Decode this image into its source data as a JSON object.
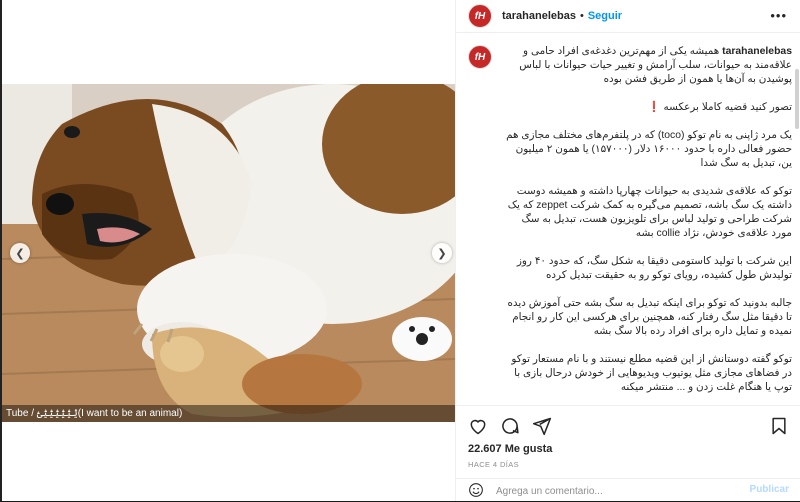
{
  "header": {
    "username": "tarahanelebas",
    "avatar_text": "fH",
    "separator": "•",
    "follow_label": "Seguir",
    "more_icon": "more-horizontal-icon"
  },
  "media": {
    "overlay_caption": "Tube / ؿؿؿؿؿؿؿ(I want to be an animal)",
    "prev_icon": "chevron-left-icon",
    "next_icon": "chevron-right-icon"
  },
  "caption": {
    "username": "tarahanelebas",
    "text": "همیشه یکی از مهم‌ترین دغدغه‌ی افراد حامی و علاقه‌مند به حیوانات، سلب آرامش و تغییر حیات حیوانات با لباس پوشیدن به آن‌ها یا همون از طریق فشن بوده\n\nتصور کنید قضیه کاملا برعکسه ❗\n\nیک مرد ژاپنی به نام توکو (toco) که در پلتفرم‌های مختلف مجازی هم حضور فعالی داره با حدود ۱۶۰۰۰ دلار (۱۵۷۰۰۰) یا همون ۲ میلیون ین، تبدیل به سگ شدا\n\nتوکو که علاقه‌ی شدیدی به حیوانات چهارپا داشته و همیشه دوست داشته یک سگ باشه، تصمیم می‌گیره به کمک شرکت zeppet که یک شرکت طراحی و تولید لباس برای تلویزیون هست، تبدیل به سگ مورد علاقه‌ی خودش، نژاد collie بشه\n\nاین شرکت با تولید کاستومی دقیقا به شکل سگ، که حدود ۴۰ روز تولیدش طول کشیده، رویای توکو رو به حقیقت تبدیل کرده\n\nجالبه بدونید که توکو برای اینکه تبدیل به سگ بشه حتی آموزش دیده تا دقیقا مثل سگ رفتار کنه، همچنین برای هرکسی این کار رو انجام نمیده و تمایل داره برای افراد رده بالا سگ بشه\n\nتوکو گفته دوستانش از این قضیه مطلع نیستند و با نام مستعار توکو در فضاهای مجازی مثل یوتیوب ویدیوهایی از خودش درحال بازی با توپ یا هنگام غلت زدن و ... منتشر میکنه\n\nشما اینکار رو تایید می‌کنید؟\nبه نظر شما کدام انسانی از سوال رفته؟"
  },
  "actions": {
    "like_icon": "heart-icon",
    "comment_icon": "comment-icon",
    "share_icon": "share-icon",
    "save_icon": "bookmark-icon",
    "likes": "22.607 Me gusta",
    "time_ago": "HACE 4 DÍAS"
  },
  "comment_bar": {
    "emoji_icon": "emoji-icon",
    "placeholder": "Agrega un comentario...",
    "publish_label": "Publicar"
  },
  "colors": {
    "accent": "#0095f6",
    "avatar": "#c62828",
    "muted": "#8e8e8e"
  }
}
